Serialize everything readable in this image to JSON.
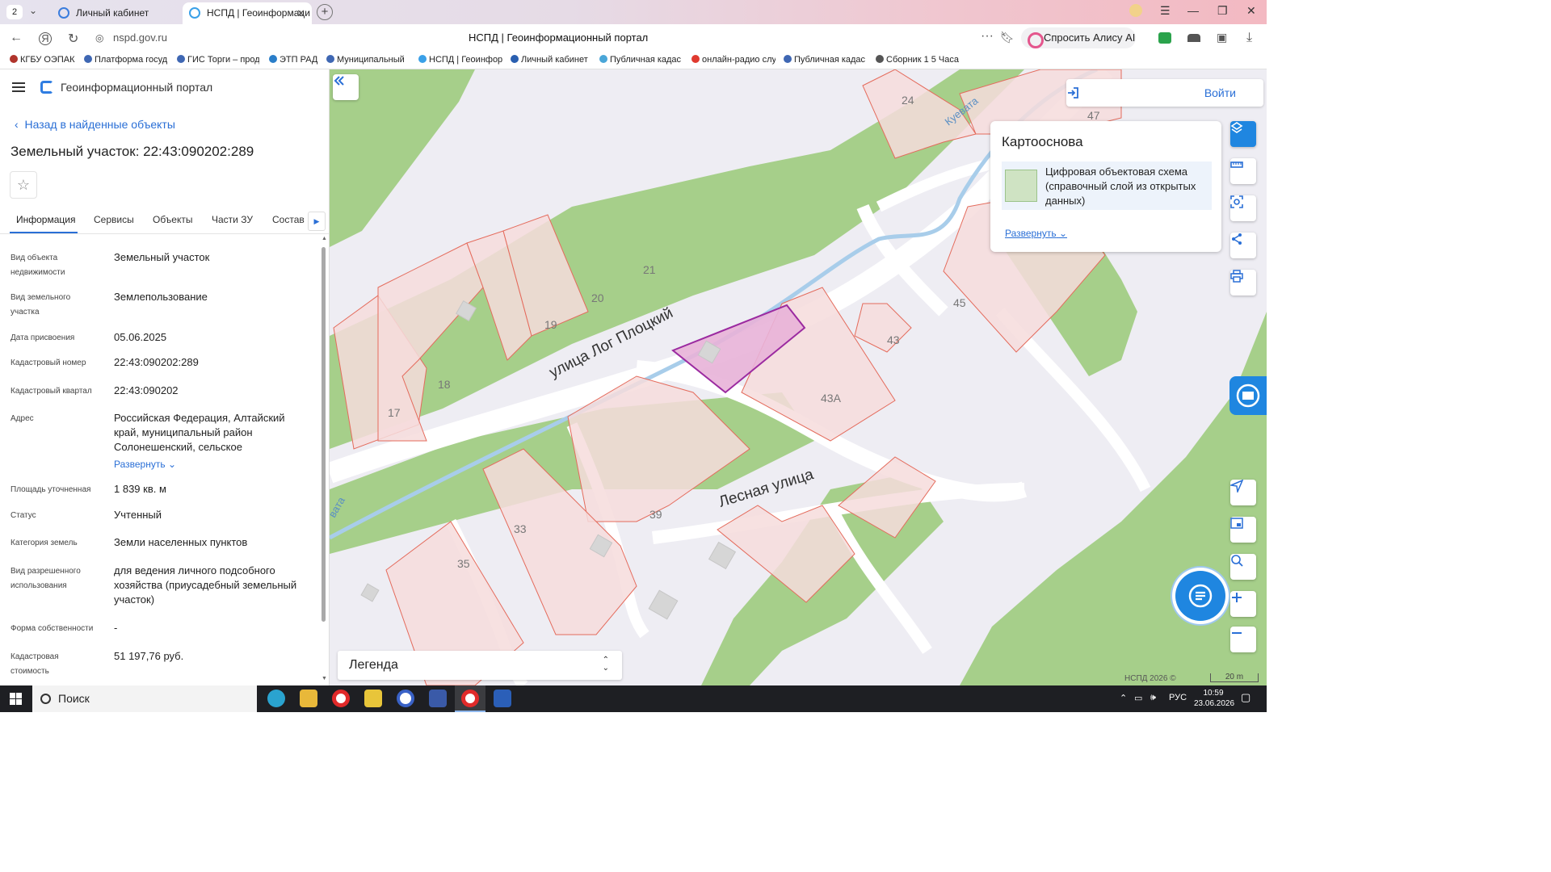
{
  "browser": {
    "tab_count": "2",
    "tabs": [
      {
        "label": "Личный кабинет"
      },
      {
        "label": "НСПД | Геоинформаци"
      }
    ],
    "url": "nspd.gov.ru",
    "page_title": "НСПД | Геоинформационный портал",
    "alice_label": "Спросить Алису AI",
    "bookmarks": [
      "КГБУ ОЭПАК",
      "Платформа госуд",
      "ГИС Торги – прод",
      "ЭТП РАД",
      "Муниципальный",
      "НСПД | Геоинфор",
      "Личный кабинет",
      "Публичная кадас",
      "онлайн-радио слу",
      "Публичная кадас",
      "Сборник 1 5 Часа"
    ]
  },
  "portal": {
    "name": "Геоинформационный портал",
    "back_link": "Назад в найденные объекты",
    "object_title": "Земельный участок: 22:43:090202:289",
    "tabs": [
      "Информация",
      "Сервисы",
      "Объекты",
      "Части ЗУ",
      "Состав"
    ],
    "fields": [
      {
        "label": "Вид объекта недвижимости",
        "value": "Земельный участок"
      },
      {
        "label": "Вид земельного участка",
        "value": "Землепользование"
      },
      {
        "label": "Дата присвоения",
        "value": "05.06.2025"
      },
      {
        "label": "Кадастровый номер",
        "value": "22:43:090202:289"
      },
      {
        "label": "Кадастровый квартал",
        "value": "22:43:090202"
      },
      {
        "label": "Адрес",
        "value": "Российская Федерация, Алтайский край, муниципальный район Солонешенский, сельское"
      },
      {
        "label": "Площадь уточненная",
        "value": "1 839 кв. м"
      },
      {
        "label": "Статус",
        "value": "Учтенный"
      },
      {
        "label": "Категория земель",
        "value": "Земли населенных пунктов"
      },
      {
        "label": "Вид разрешенного использования",
        "value": "для ведения личного подсобного хозяйства (приусадебный земельный участок)"
      },
      {
        "label": "Форма собственности",
        "value": "-"
      },
      {
        "label": "Кадастровая стоимость",
        "value": "51 197,76 руб."
      }
    ],
    "address_expand": "Развернуть"
  },
  "map": {
    "login_label": "Войти",
    "basemap": {
      "title": "Картооснова",
      "layer_name": "Цифровая объектовая схема (справочный слой из открытых данных)",
      "expand_label": "Развернуть"
    },
    "legend_label": "Легенда",
    "copyright": "НСПД 2026 ©",
    "scale": "20 m",
    "street_labels": [
      "улица Лог Плоцкий",
      "Лесная улица",
      "Куевата",
      "вата"
    ],
    "parcel_numbers": [
      "24",
      "47",
      "21",
      "20",
      "19",
      "18",
      "17",
      "45",
      "43",
      "43А",
      "39",
      "33",
      "35"
    ],
    "colors": {
      "park_green": "#a6cf8a",
      "parcel_fill": "#f6dcdc",
      "parcel_stroke": "#e46b5c",
      "selected_fill": "#e8b3d8",
      "selected_stroke": "#9b2aa0",
      "water": "#a8cdea",
      "accent": "#1f86e0"
    }
  },
  "taskbar": {
    "search_label": "Поиск",
    "language": "РУС",
    "time": "10:59",
    "date": "23.06.2026"
  }
}
